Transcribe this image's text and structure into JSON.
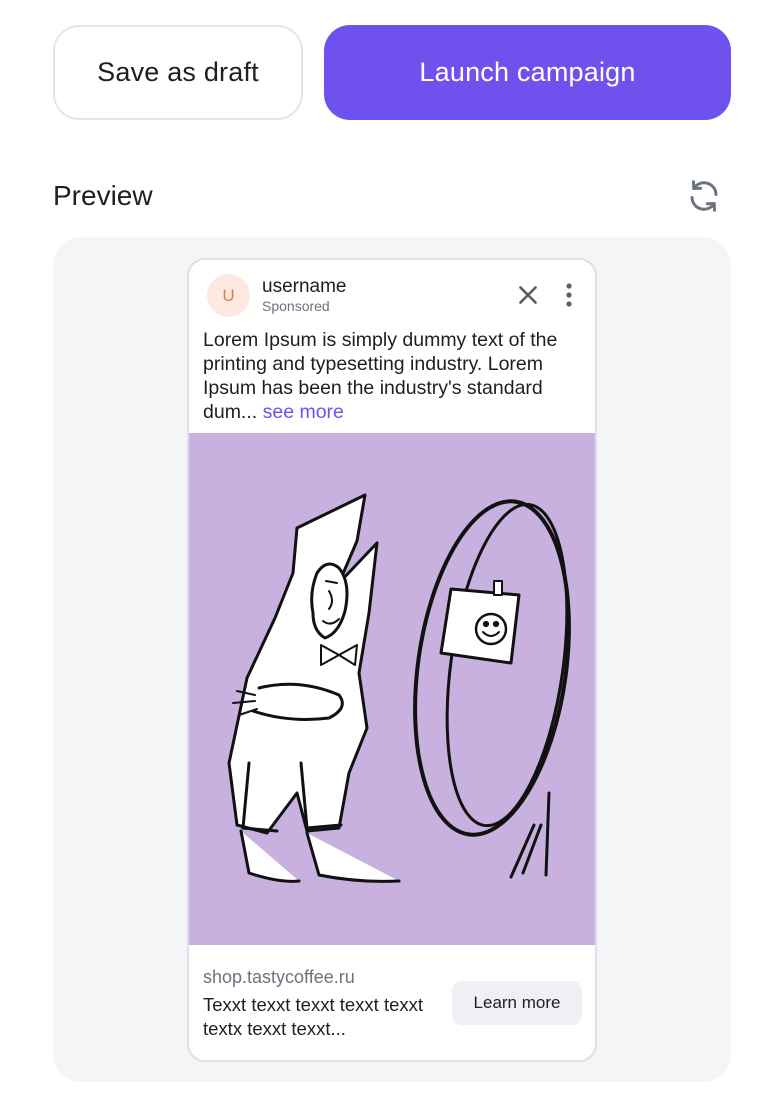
{
  "actions": {
    "draft_label": "Save as draft",
    "launch_label": "Launch campaign"
  },
  "preview": {
    "title": "Preview",
    "refresh_icon": "refresh-icon"
  },
  "ad": {
    "avatar_letter": "U",
    "username": "username",
    "sponsored": "Sponsored",
    "body_text": "Lorem Ipsum is simply dummy text of the printing and typesetting industry. Lorem Ipsum has been the industry's standard dum... ",
    "see_more": "see more",
    "image_description_icon": "illustration-icon",
    "url": "shop.tastycoffee.ru",
    "footer_text": "Texxt texxt texxt texxt texxt textx texxt texxt...",
    "cta_label": "Learn more"
  },
  "colors": {
    "accent": "#6f52ed",
    "image_background": "#c8b1df",
    "panel_background": "#f4f5f7",
    "avatar_background": "#fde9e1",
    "avatar_text": "#e3784a"
  }
}
